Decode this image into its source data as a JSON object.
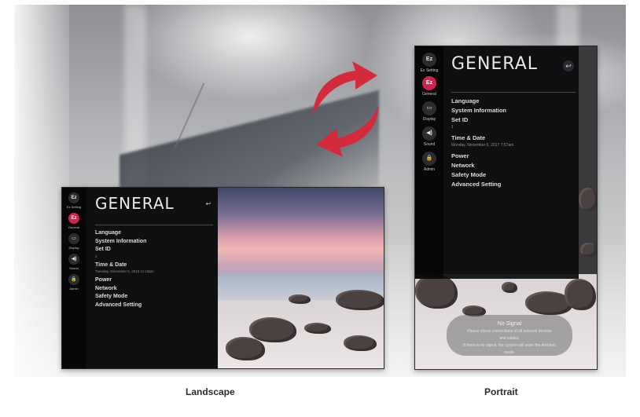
{
  "menu": {
    "title": "GENERAL",
    "back_icon": "back-arrow-icon",
    "rail": [
      {
        "label": "Ez Setting",
        "icon": "ez-setting-icon",
        "glyph": "Ez",
        "active": false
      },
      {
        "label": "General",
        "icon": "general-icon",
        "glyph": "Ez",
        "active": true
      },
      {
        "label": "Display",
        "icon": "display-icon",
        "glyph": "▭",
        "active": false
      },
      {
        "label": "Sound",
        "icon": "sound-icon",
        "glyph": "◀)",
        "active": false
      },
      {
        "label": "Admin",
        "icon": "lock-icon",
        "glyph": "🔒",
        "active": false
      }
    ],
    "items": [
      {
        "label": "Language"
      },
      {
        "label": "System Information"
      },
      {
        "label": "Set ID",
        "sub": "1"
      },
      {
        "label": "Time & Date"
      },
      {
        "label": "Power"
      },
      {
        "label": "Network"
      },
      {
        "label": "Safety Mode"
      },
      {
        "label": "Advanced Setting"
      }
    ]
  },
  "landscape": {
    "caption": "Landscape",
    "time_date_sub": "Tuesday, December 6, 2016 11:18pm"
  },
  "portrait": {
    "caption": "Portrait",
    "time_date_sub": "Monday, November 6, 2017 7:57am",
    "popup": {
      "title": "No Signal",
      "line1": "Please check connections of all external devices",
      "line2": "and cables.",
      "line3": "If there is no signal, the system will enter the Ambient",
      "line4": "mode."
    }
  },
  "colors": {
    "accent": "#d2214e",
    "menu_bg": "#0e0f11",
    "arrow": "#d42a3c"
  }
}
